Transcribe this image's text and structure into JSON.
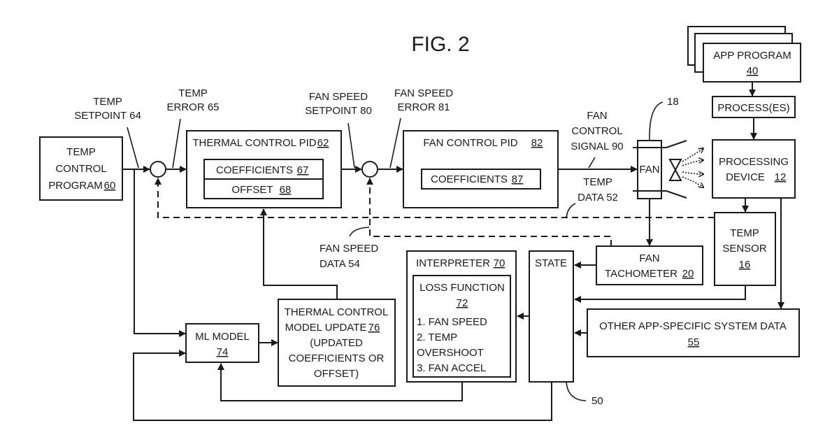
{
  "figure": {
    "title": "FIG. 2"
  },
  "blocks": {
    "temp_control_program": {
      "lines": [
        "TEMP",
        "CONTROL",
        "PROGRAM"
      ],
      "ref": "60"
    },
    "thermal_control_pid": {
      "label": "THERMAL CONTROL PID",
      "ref": "62",
      "coefficients": {
        "label": "COEFFICIENTS",
        "ref": "67"
      },
      "offset": {
        "label": "OFFSET",
        "ref": "68"
      }
    },
    "fan_control_pid": {
      "label": "FAN CONTROL PID",
      "ref": "82",
      "coefficients": {
        "label": "COEFFICIENTS",
        "ref": "87"
      }
    },
    "fan": {
      "label": "FAN",
      "ref": "18"
    },
    "app_program": {
      "label": "APP PROGRAM",
      "ref": "40"
    },
    "processes": {
      "label": "PROCESS(ES)"
    },
    "processing_device": {
      "label": "PROCESSING",
      "label2": "DEVICE",
      "ref": "12"
    },
    "temp_sensor": {
      "lines": [
        "TEMP",
        "SENSOR"
      ],
      "ref": "16"
    },
    "fan_tachometer": {
      "label": "FAN",
      "label2": "TACHOMETER",
      "ref": "20"
    },
    "state": {
      "label": "STATE",
      "ref": "50"
    },
    "interpreter": {
      "label": "INTERPRETER",
      "ref": "70",
      "loss_function": {
        "label": "LOSS FUNCTION",
        "ref": "72",
        "items": [
          "1. FAN SPEED",
          "2. TEMP",
          "OVERSHOOT",
          "3. FAN ACCEL"
        ]
      }
    },
    "ml_model": {
      "label": "ML MODEL",
      "ref": "74"
    },
    "thermal_model_update": {
      "lines": [
        "THERMAL CONTROL",
        "MODEL UPDATE",
        "(UPDATED",
        "COEFFICIENTS OR",
        "OFFSET)"
      ],
      "ref": "76"
    },
    "other_system_data": {
      "label": "OTHER APP-SPECIFIC SYSTEM DATA",
      "ref": "55"
    }
  },
  "signals": {
    "temp_setpoint": [
      "TEMP",
      "SETPOINT 64"
    ],
    "temp_error": [
      "TEMP",
      "ERROR 65"
    ],
    "fan_speed_setpoint": [
      "FAN SPEED",
      "SETPOINT 80"
    ],
    "fan_speed_error": [
      "FAN SPEED",
      "ERROR 81"
    ],
    "fan_control_signal": [
      "FAN",
      "CONTROL",
      "SIGNAL 90"
    ],
    "temp_data": [
      "TEMP",
      "DATA 52"
    ],
    "fan_speed_data": [
      "FAN SPEED",
      "DATA 54"
    ]
  }
}
